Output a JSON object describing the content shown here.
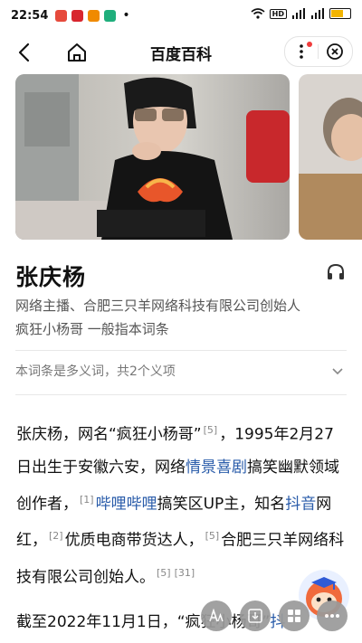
{
  "status_bar": {
    "time": "22:54",
    "hd_badge": "HD",
    "signal_label_1": "4G",
    "signal_label_2": "4G",
    "colors": [
      "#e64a3c",
      "#d8262e",
      "#f08a00",
      "#1fae7c"
    ]
  },
  "nav": {
    "title": "百度百科",
    "icons": [
      "back-arrow-icon",
      "home-icon",
      "more-dots-icon",
      "close-circle-icon"
    ]
  },
  "entry": {
    "title": "张庆杨",
    "subtitle_line1": "网络主播、合肥三只羊网络科技有限公司创始人",
    "subtitle_line2": "疯狂小杨哥 一般指本词条",
    "polysemy_note": "本词条是多义词，共2个义项"
  },
  "body": {
    "p1_a": "张庆杨，网名“疯狂小杨哥”",
    "ref_5a": "[5]",
    "p1_b": "，1995年2月27日出生于安徽六安，网络",
    "link_qingjing": "情景喜剧",
    "p1_c": "搞笑幽默领域创作者，",
    "ref_1": "[1]",
    "link_bilibili": "哔哩哔哩",
    "p1_d": "搞笑区UP主，知名",
    "link_douyin": "抖音",
    "p1_e": "网红，",
    "ref_2": "[2]",
    "p1_f": "优质电商带货达人，",
    "ref_5b": "[5]",
    "p1_g": "合肥三只羊网络科技有限公司创始人。",
    "ref_5c": "[5]",
    "ref_31": "[31]",
    "p2_a": "截至2022年11月1日，“疯狂小杨哥”",
    "p2_link": "抖"
  },
  "floating": {
    "buttons": [
      "font-size-icon",
      "download-icon",
      "grid-icon",
      "more-icon"
    ]
  }
}
